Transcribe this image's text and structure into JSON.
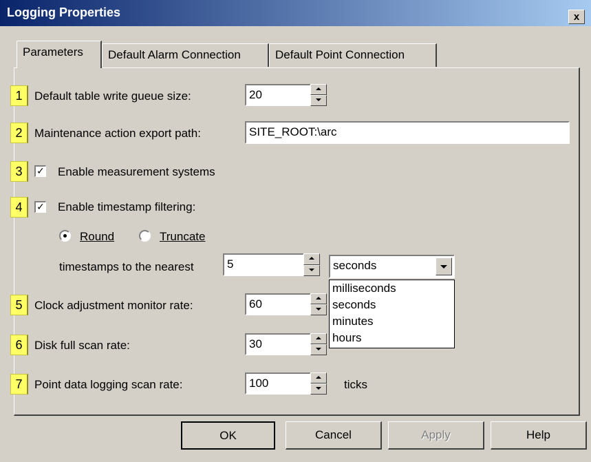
{
  "window": {
    "title": "Logging Properties",
    "close_glyph": "x"
  },
  "tabs": [
    {
      "label": "Parameters",
      "active": true
    },
    {
      "label": "Default Alarm Connection",
      "active": false
    },
    {
      "label": "Default Point Connection",
      "active": false
    }
  ],
  "fields": {
    "f1": {
      "badge": "1",
      "label": "Default table write gueue size:",
      "value": "20"
    },
    "f2": {
      "badge": "2",
      "label": "Maintenance action export path:",
      "value": "SITE_ROOT:\\arc"
    },
    "f3": {
      "badge": "3",
      "label": "Enable measurement systems",
      "checked": true
    },
    "f4": {
      "badge": "4",
      "label": "Enable timestamp filtering:",
      "checked": true
    },
    "f5": {
      "badge": "5",
      "label": "Clock adjustment monitor rate:",
      "value": "60"
    },
    "f6": {
      "badge": "6",
      "label": "Disk full scan rate:",
      "value": "30"
    },
    "f7": {
      "badge": "7",
      "label": "Point data logging scan rate:",
      "value": "100",
      "unit": "ticks"
    }
  },
  "rounding": {
    "round_label": "Round",
    "truncate_label": "Truncate",
    "selected": "Round",
    "nearest_label": "timestamps to the nearest",
    "nearest_value": "5",
    "unit_selected": "seconds",
    "unit_options": [
      "milliseconds",
      "seconds",
      "minutes",
      "hours"
    ]
  },
  "buttons": {
    "ok": "OK",
    "cancel": "Cancel",
    "apply": "Apply",
    "help": "Help"
  },
  "colors": {
    "title_start": "#0a246a",
    "title_end": "#a6caf0",
    "badge": "#ffff66",
    "face": "#d4d0c8"
  }
}
